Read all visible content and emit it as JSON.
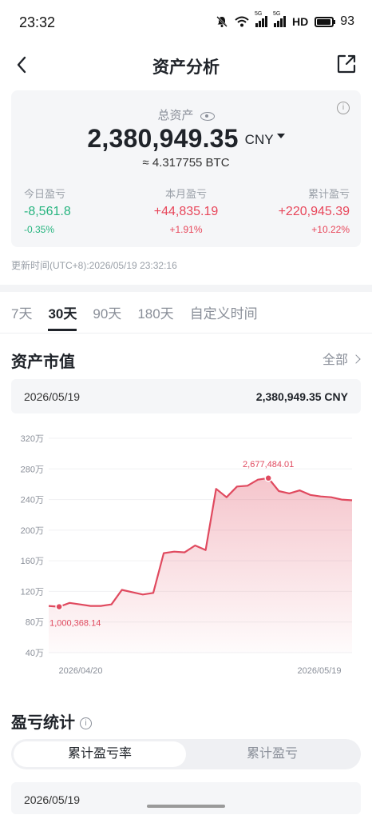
{
  "status_bar": {
    "time": "23:32",
    "network": "HD",
    "battery": "93"
  },
  "header": {
    "title": "资产分析"
  },
  "summary": {
    "total_label": "总资产",
    "total_value": "2,380,949.35",
    "currency": "CNY",
    "btc_value": "≈ 4.317755 BTC",
    "today": {
      "label": "今日盈亏",
      "value": "-8,561.8",
      "pct": "-0.35%"
    },
    "month": {
      "label": "本月盈亏",
      "value": "+44,835.19",
      "pct": "+1.91%"
    },
    "cumulative": {
      "label": "累计盈亏",
      "value": "+220,945.39",
      "pct": "+10.22%"
    }
  },
  "update_time": "更新时间(UTC+8):2026/05/19 23:32:16",
  "tabs": [
    "7天",
    "30天",
    "90天",
    "180天",
    "自定义时间"
  ],
  "active_tab": "30天",
  "market_value": {
    "title": "资产市值",
    "all_label": "全部",
    "selected_date": "2026/05/19",
    "selected_value": "2,380,949.35 CNY"
  },
  "chart_data": {
    "type": "area",
    "y_tick_labels": [
      "320万",
      "280万",
      "240万",
      "200万",
      "160万",
      "120万",
      "80万",
      "40万"
    ],
    "y_ticks": [
      320,
      280,
      240,
      200,
      160,
      120,
      80,
      40
    ],
    "ylim": [
      40,
      320
    ],
    "x_tick_labels": [
      "2026/04/20",
      "2026/05/19"
    ],
    "unit": "万",
    "values": [
      101,
      100,
      105,
      103,
      101,
      101,
      103,
      122,
      119,
      116,
      118,
      170,
      172,
      171,
      180,
      174,
      254,
      243,
      257,
      258,
      266,
      268,
      251,
      248,
      252,
      246,
      244,
      243,
      240,
      239
    ],
    "min_index": 1,
    "min_label": "1,000,368.14",
    "max_index": 21,
    "max_label": "2,677,484.01",
    "line_color": "#e04a5f",
    "grid": true
  },
  "pnl_stats": {
    "title": "盈亏统计",
    "options": [
      "累计盈亏率",
      "累计盈亏"
    ],
    "active_option": "累计盈亏率",
    "next_date_partial": "2026/05/19"
  },
  "colors": {
    "up": "#e8465a",
    "down": "#26b47f",
    "text": "#1f2329"
  }
}
